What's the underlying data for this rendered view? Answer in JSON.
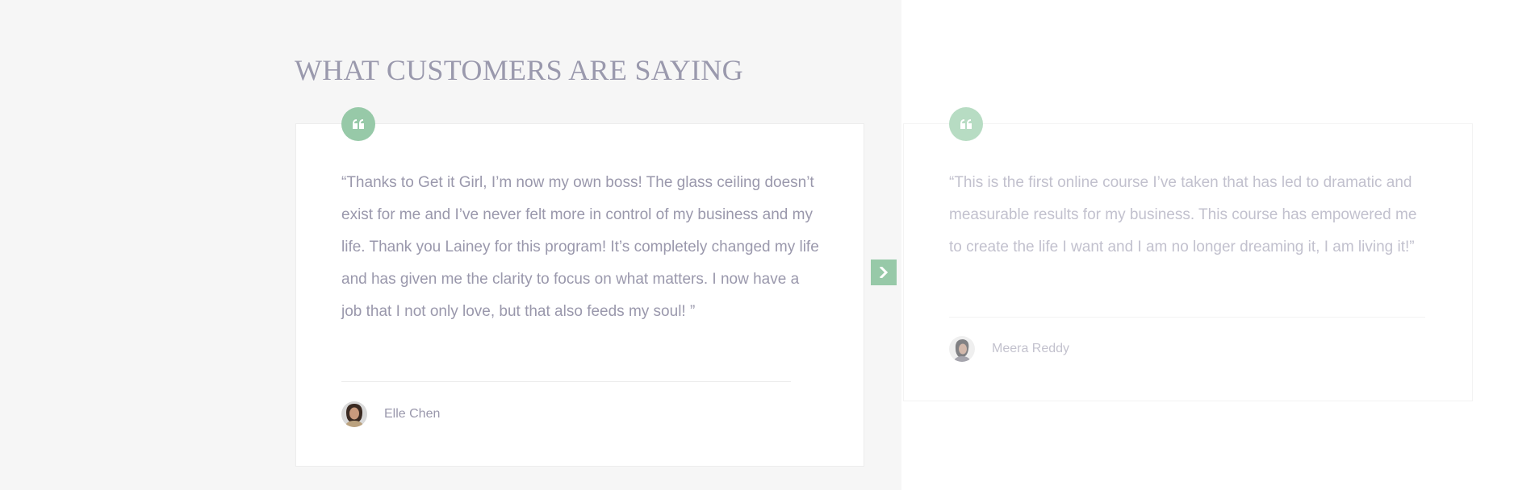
{
  "section": {
    "title": "WHAT CUSTOMERS ARE SAYING"
  },
  "colors": {
    "accent": "#97c9a8",
    "title": "#9a99ad",
    "text": "#9a98ac",
    "panel_background": "#f6f6f6"
  },
  "testimonials": [
    {
      "quote": "“Thanks to Get it Girl, I’m now my own boss! The glass ceiling doesn’t exist for me and I’ve never felt more in control of my business and my life. Thank you Lainey for this program! It’s completely changed my life and has given me the clarity to focus on what matters. I now have a job that I not only love, but that also feeds my soul! ”",
      "author": "Elle Chen",
      "icon": "quote-icon",
      "avatar": "avatar-photo"
    },
    {
      "quote": "“This is the first online course I’ve taken that has led to dramatic and measurable results for my business. This course has empowered me to create the life I want and I am no longer dreaming it, I am living it!”",
      "author": "Meera Reddy",
      "icon": "quote-icon",
      "avatar": "avatar-photo"
    }
  ],
  "navigation": {
    "next_icon": "chevron-right-icon"
  }
}
